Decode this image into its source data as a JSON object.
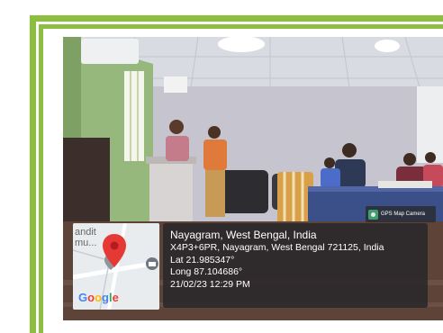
{
  "gps_camera": {
    "badge_label": "GPS Map Camera",
    "location_title": "Nayagram, West Bengal, India",
    "address": "X4P3+6PR, Nayagram, West Bengal 721125, India",
    "latitude": "Lat 21.985347°",
    "longitude": "Long 87.104686°",
    "timestamp": "21/02/23 12:29 PM"
  },
  "map": {
    "place_label_line1": "andit",
    "place_label_line2": "mu...",
    "google_logo": "Google",
    "pin_color": "#e53935"
  },
  "colors": {
    "frame_green": "#8cbf3f"
  }
}
